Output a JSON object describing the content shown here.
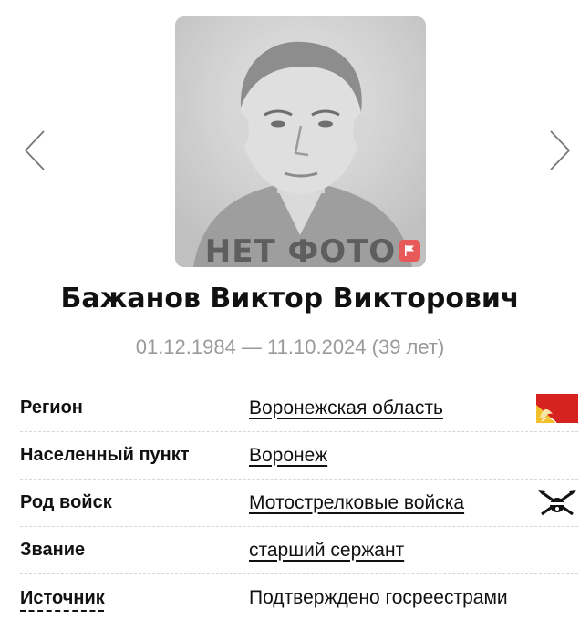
{
  "navigation": {
    "prev_icon": "chevron-left-icon",
    "next_icon": "chevron-right-icon"
  },
  "photo": {
    "placeholder_text": "НЕТ ФОТО",
    "badge_icon": "flag-icon",
    "badge_color": "#e85a5a"
  },
  "person": {
    "name": "Бажанов Виктор Викторович",
    "birth_date": "01.12.1984",
    "dash": " — ",
    "death_date": "11.10.2024",
    "age": " (39 лет)"
  },
  "info": {
    "rows": [
      {
        "label": "Регион",
        "value": "Воронежская область",
        "icon": "voronezh-region-flag-icon"
      },
      {
        "label": "Населенный пункт",
        "value": "Воронеж"
      },
      {
        "label": "Род войск",
        "value": "Мотострелковые войска",
        "icon": "motor-rifle-troops-emblem-icon"
      },
      {
        "label": "Звание",
        "value": "старший сержант"
      },
      {
        "label": "Источник",
        "value": "Подтверждено госреестрами"
      }
    ]
  },
  "colors": {
    "muted_text": "#9a9a9a",
    "flag_red": "#d6231f",
    "flag_gold": "#f2c12e"
  }
}
